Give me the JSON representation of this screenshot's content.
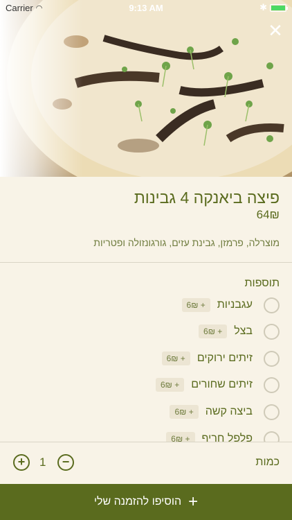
{
  "status_bar": {
    "carrier": "Carrier",
    "time": "9:13 AM"
  },
  "item": {
    "title": "פיצה ביאנקה 4 גבינות",
    "price": "64₪",
    "description": "מוצרלה, פרמזן, גבינת עזים, גורגונזולה ופטריות"
  },
  "addons": {
    "title": "תוספות",
    "items": [
      {
        "name": "עגבניות",
        "price": "+ 6₪"
      },
      {
        "name": "בצל",
        "price": "+ 6₪"
      },
      {
        "name": "זיתים ירוקים",
        "price": "+ 6₪"
      },
      {
        "name": "זיתים שחורים",
        "price": "+ 6₪"
      },
      {
        "name": "ביצה קשה",
        "price": "+ 6₪"
      },
      {
        "name": "פלפל חריף",
        "price": "+ 6₪"
      }
    ]
  },
  "quantity": {
    "label": "כמות",
    "value": "1"
  },
  "cta": {
    "label": "הוסיפו להזמנה שלי"
  },
  "colors": {
    "accent": "#5a6b1e",
    "background": "#f8f3e7"
  }
}
